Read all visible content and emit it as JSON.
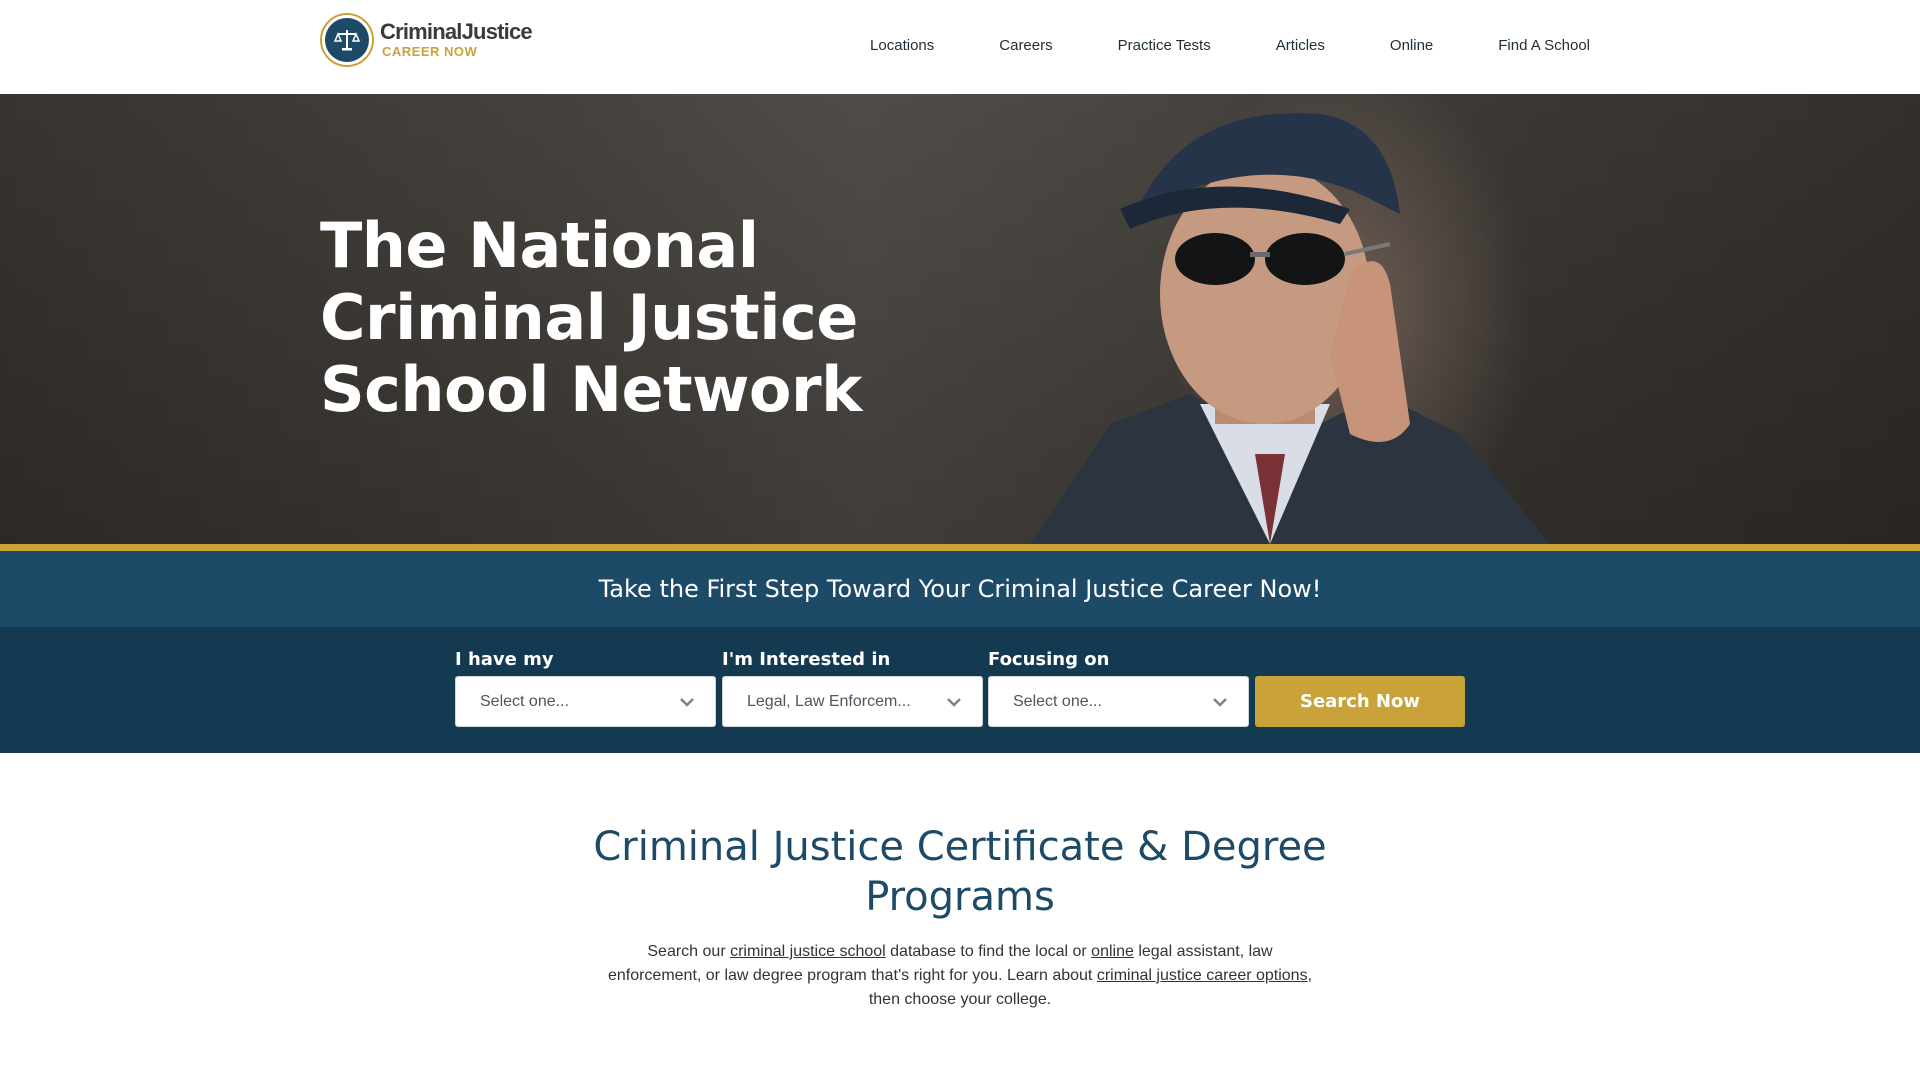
{
  "logo": {
    "title": "CriminalJustice",
    "subtitle": "CAREER NOW",
    "icon": "scales-of-justice-icon"
  },
  "nav": {
    "items": [
      "Locations",
      "Careers",
      "Practice Tests",
      "Articles",
      "Online",
      "Find A School"
    ]
  },
  "hero": {
    "title": "The National Criminal Justice School Network"
  },
  "cta": {
    "text": "Take the First Step Toward Your Criminal Justice Career Now!"
  },
  "search": {
    "fields": [
      {
        "label": "I have my",
        "value": "Select one..."
      },
      {
        "label": "I'm Interested in",
        "value": "Legal, Law Enforcem..."
      },
      {
        "label": "Focusing on",
        "value": "Select one..."
      }
    ],
    "button_label": "Search Now"
  },
  "section": {
    "title": "Criminal Justice Certificate & Degree Programs",
    "body": {
      "t1": "Search our ",
      "link1": "criminal justice school",
      "t2": " database to find the local or ",
      "link2": "online",
      "t3": " legal assistant, law enforcement, or law degree program that’s right for you. Learn about ",
      "link3": "criminal justice career options",
      "t4": ", then choose your college."
    }
  },
  "colors": {
    "brand_navy": "#1d4a66",
    "brand_dark": "#143a52",
    "brand_gold": "#c9a23a"
  }
}
